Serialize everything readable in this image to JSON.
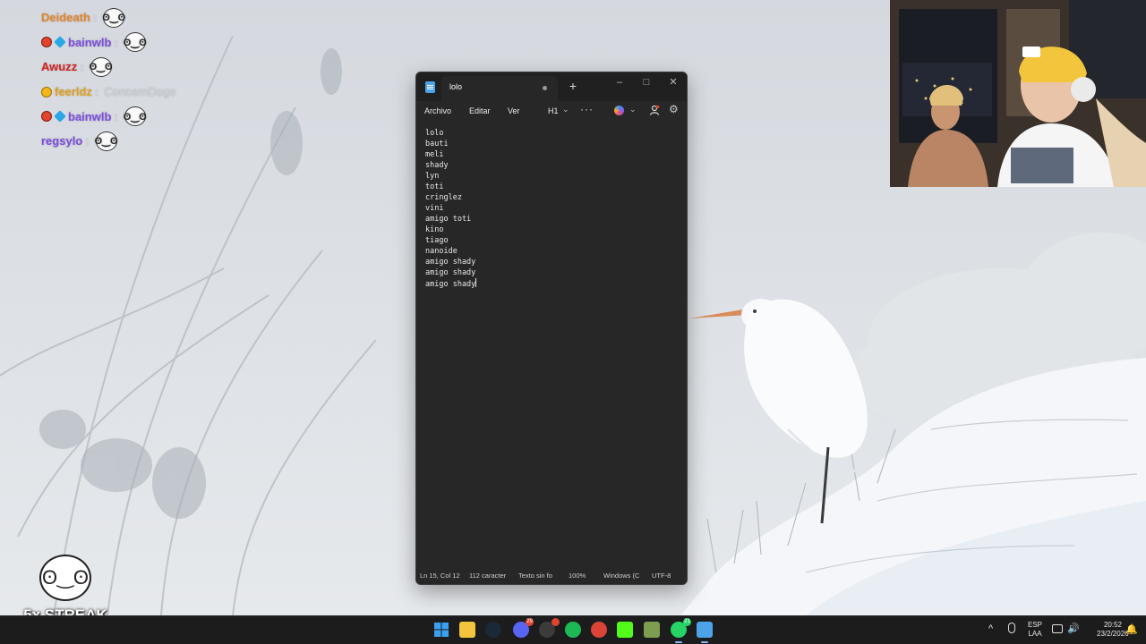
{
  "chat": {
    "lines": [
      {
        "badges": [],
        "name": "Deideath",
        "color": "#e5862c",
        "message": "",
        "emote": "pogface-emote"
      },
      {
        "badges": [
          "red",
          "cube"
        ],
        "name": "bainwlb",
        "color": "#7d4de0",
        "message": "",
        "emote": "pogface-emote"
      },
      {
        "badges": [],
        "name": "Awuzz",
        "color": "#d3221f",
        "message": "",
        "emote": "pogface-emote"
      },
      {
        "badges": [
          "gold"
        ],
        "name": "feerldz",
        "color": "#e3a11b",
        "message": "ConcernDoge",
        "emote": ""
      },
      {
        "badges": [
          "red",
          "cube"
        ],
        "name": "bainwlb",
        "color": "#7d4de0",
        "message": "",
        "emote": "pogface-emote"
      },
      {
        "badges": [],
        "name": "regsylo",
        "color": "#7d4de0",
        "message": "",
        "emote": "pogface-emote"
      }
    ]
  },
  "streak": {
    "label": "5x STREAK"
  },
  "notepad": {
    "tab_title": "lolo",
    "new_tab": "+",
    "window_controls": {
      "minimize": "–",
      "maximize": "□",
      "close": "✕"
    },
    "menu": {
      "file": "Archivo",
      "edit": "Editar",
      "view": "Ver",
      "heading": "H1",
      "more": "···"
    },
    "content_lines": [
      "lolo",
      "bauti",
      "meli",
      "shady",
      "lyn",
      "toti",
      "cringlez",
      "vini",
      "amigo toti",
      "kino",
      "tiago",
      "nanoide",
      "amigo shady",
      "amigo shady",
      "amigo shady"
    ],
    "status": {
      "position": "Ln 15, Col 12",
      "chars": "112 caracter",
      "format": "Texto sin fo",
      "zoom": "100%",
      "line_ending": "Windows (C",
      "encoding": "UTF-8"
    }
  },
  "taskbar": {
    "icons": [
      {
        "name": "start-icon",
        "color": "#3aa0f2"
      },
      {
        "name": "file-explorer-icon",
        "color": "#f2c53d"
      },
      {
        "name": "steam-icon",
        "color": "#1b2838"
      },
      {
        "name": "discord-icon",
        "color": "#5865f2",
        "badge": "29"
      },
      {
        "name": "obs-icon",
        "color": "#3b3b3b",
        "badge": ""
      },
      {
        "name": "spotify-icon",
        "color": "#1db954"
      },
      {
        "name": "chrome-icon",
        "color": "#db4437"
      },
      {
        "name": "kick-icon",
        "color": "#53fc18"
      },
      {
        "name": "minecraft-icon",
        "color": "#7c9e4e"
      },
      {
        "name": "whatsapp-icon",
        "color": "#25d366",
        "badge": "21"
      },
      {
        "name": "notepad-icon",
        "color": "#4da3e8"
      }
    ],
    "tray": {
      "caret": "^",
      "lang_line1": "ESP",
      "lang_line2": "LAA",
      "volume": "🔊",
      "time": "20:52",
      "date": "23/2/2026",
      "bell": "🔔"
    }
  }
}
